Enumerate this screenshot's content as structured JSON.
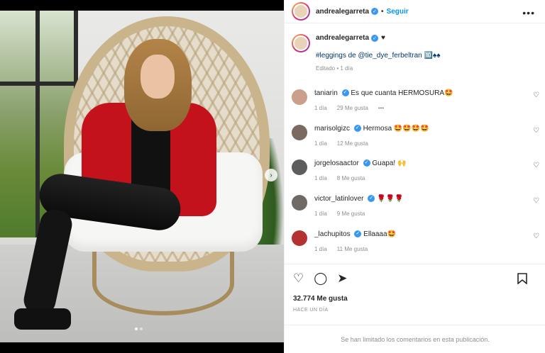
{
  "post": {
    "author": "andrealegarreta",
    "follow_label": "Seguir",
    "separator": "•",
    "more_icon": "more-icon"
  },
  "caption": {
    "author": "andrealegarreta",
    "suffix": "♥",
    "text": "#leggings de @tie_dye_ferbeltran 🔟♠♠",
    "meta": "Editado • 1 día"
  },
  "comments": [
    {
      "user": "taniarin",
      "text": "Es que cuanta HERMOSURA🤩",
      "time": "1 día",
      "likes": "29 Me gusta",
      "extra": "•••"
    },
    {
      "user": "marisolgizc",
      "text": "Hermosa 🤩🤩🤩🤩",
      "time": "1 día",
      "likes": "12 Me gusta"
    },
    {
      "user": "jorgelosaactor",
      "text": "Guapa! 🙌",
      "time": "1 día",
      "likes": "8 Me gusta"
    },
    {
      "user": "victor_latinlover",
      "text": "🌹🌹🌹",
      "time": "1 día",
      "likes": "9 Me gusta"
    },
    {
      "user": "_lachupitos",
      "text": "Ellaaaa🤩",
      "time": "1 día",
      "likes": "11 Me gusta"
    }
  ],
  "stats": {
    "likes": "32.774 Me gusta",
    "when": "HACE UN DÍA"
  },
  "footer": {
    "limited": "Se han limitado los comentarios en esta publicación."
  },
  "carousel": {
    "slides": 2,
    "active": 1
  },
  "colors": {
    "link": "#0095f6",
    "verified": "#3897f0",
    "muted": "#8e8e8e"
  }
}
